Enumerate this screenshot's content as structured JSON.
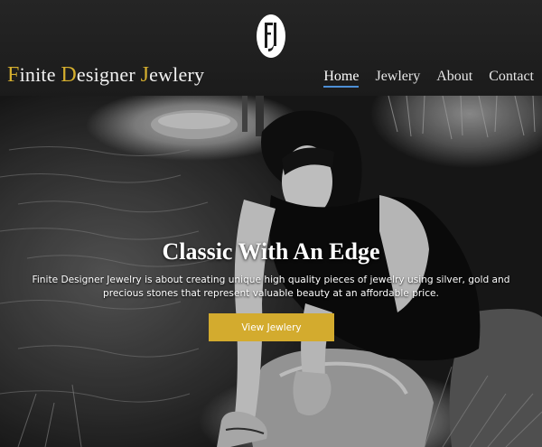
{
  "header": {
    "logo_icon": "fj-monogram-icon",
    "brand": {
      "parts": [
        {
          "initial": "F",
          "rest": "inite "
        },
        {
          "initial": "D",
          "rest": "esigner "
        },
        {
          "initial": "J",
          "rest": "ewlery"
        }
      ]
    },
    "nav": [
      {
        "label": "Home",
        "active": true
      },
      {
        "label": "Jewlery",
        "active": false
      },
      {
        "label": "About",
        "active": false
      },
      {
        "label": "Contact",
        "active": false
      }
    ]
  },
  "hero": {
    "image": "woman-kneeling-by-stream-photo",
    "title": "Classic With An Edge",
    "text": "Finite Designer Jewelry is about creating unique high quality pieces of jewelry using silver, gold and precious stones that represent valuable beauty at an affordable price.",
    "button_label": "View Jewlery"
  },
  "colors": {
    "accent": "#d3ab2e",
    "header_bg": "#222222",
    "nav_underline": "#4d8fd6"
  }
}
